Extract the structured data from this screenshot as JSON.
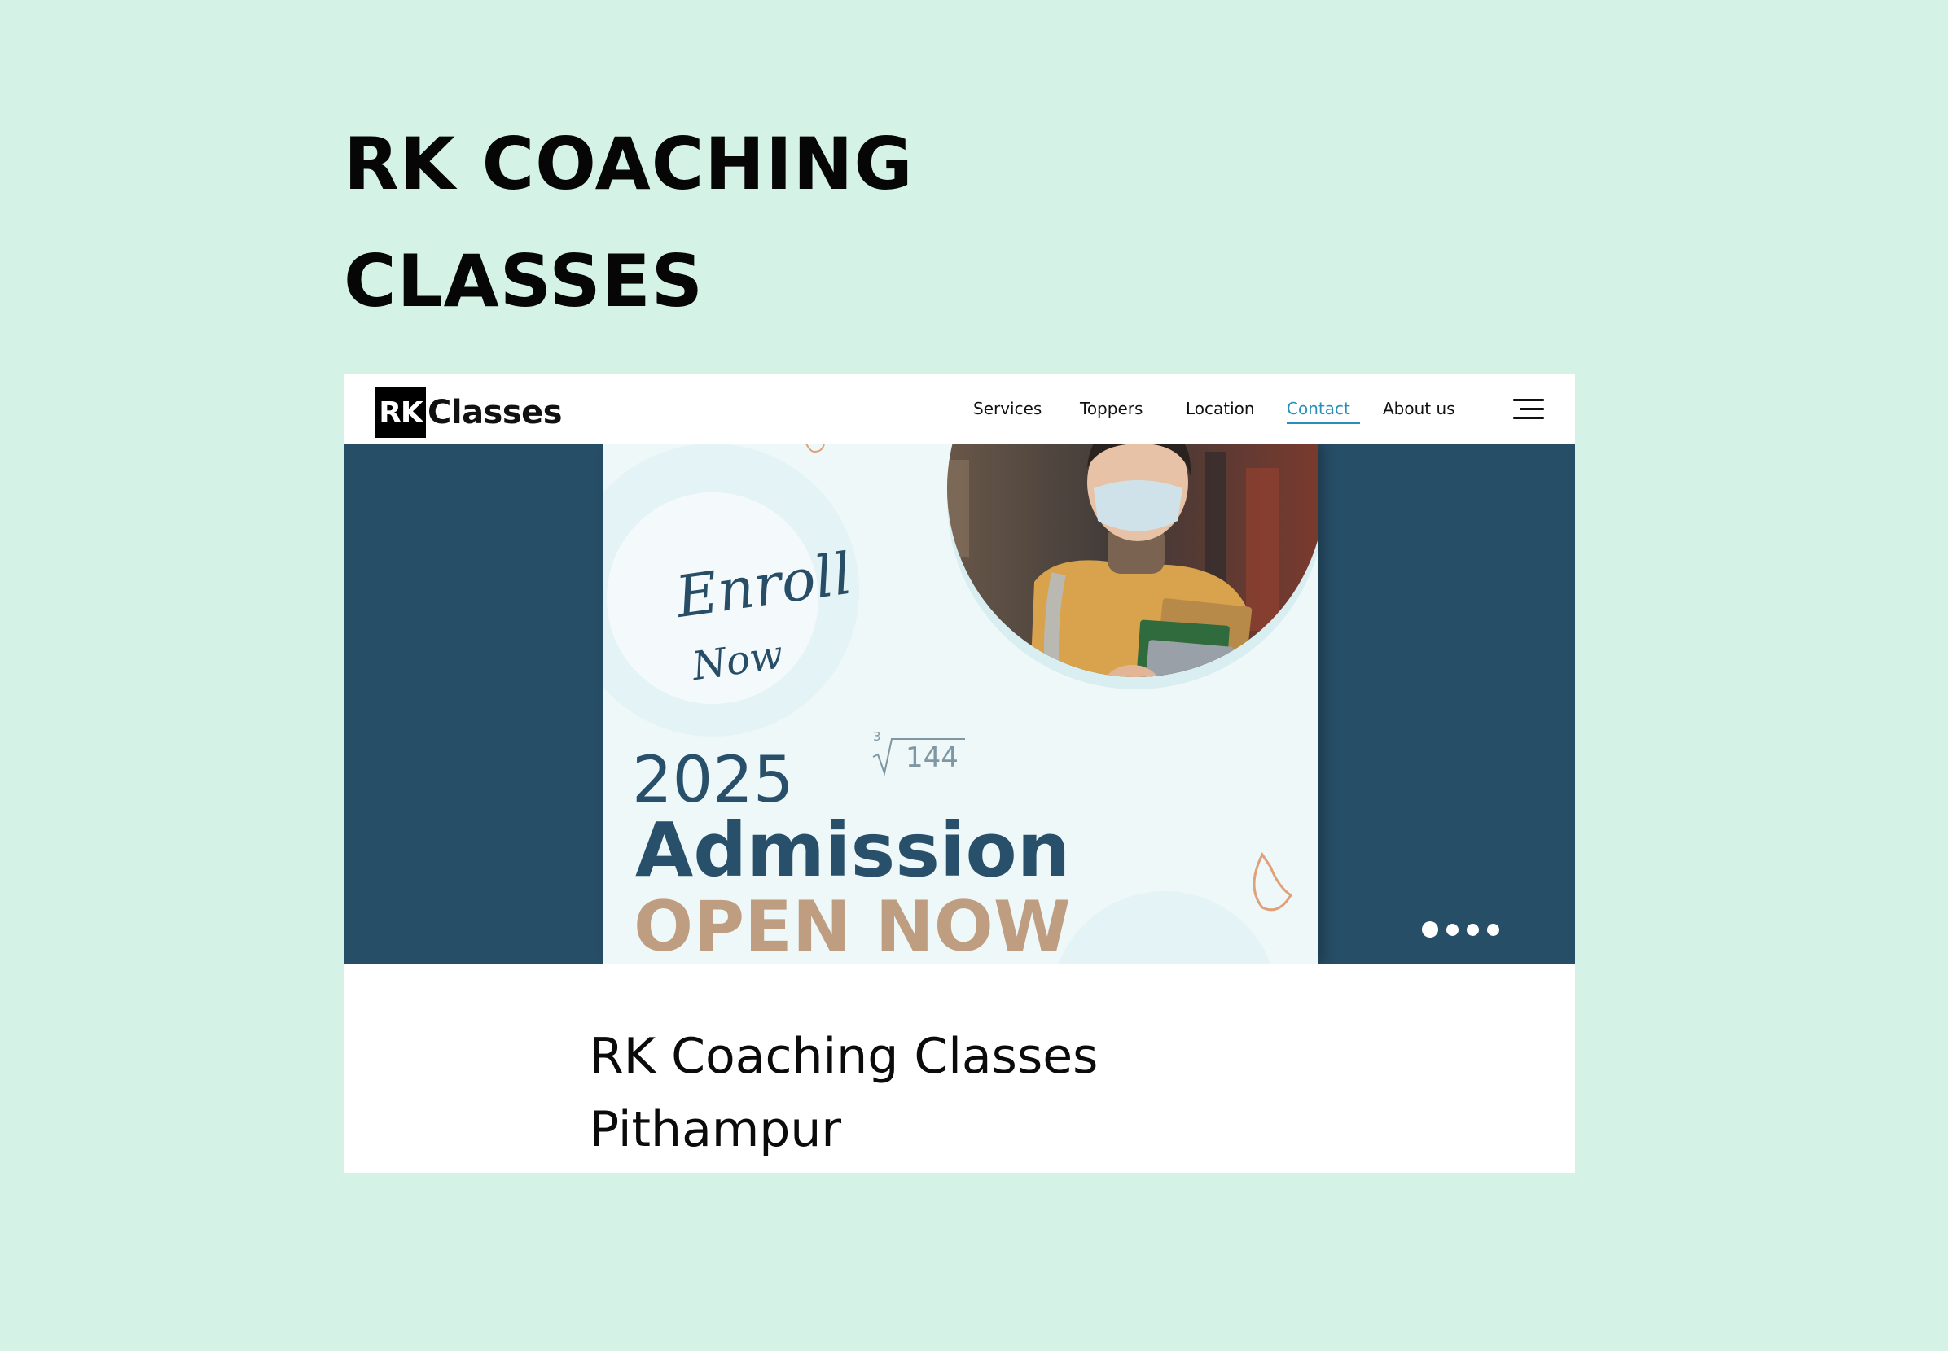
{
  "page": {
    "heading_line1": "RK COACHING",
    "heading_line2": "CLASSES",
    "background_color": "#d4f3e6"
  },
  "site": {
    "logo": {
      "mark": "RK",
      "text": "Classes"
    },
    "nav": {
      "items": [
        {
          "label": "Services"
        },
        {
          "label": "Toppers"
        },
        {
          "label": "Location"
        },
        {
          "label": "Contact",
          "active": true
        },
        {
          "label": "About us"
        }
      ],
      "active_color": "#2a8fb8"
    },
    "hero": {
      "background_color": "#274e67",
      "banner": {
        "script_line1": "Enroll",
        "script_line2": "Now",
        "math_index": "3",
        "math_radicand": "144",
        "year": "2025",
        "headline": "Admission",
        "subheadline": "OPEN NOW",
        "headline_color": "#29506b",
        "subheadline_color": "#bf9d80"
      },
      "slider": {
        "slide_count": 4,
        "active_index": 0
      }
    },
    "title_line1": "RK Coaching Classes",
    "title_line2": "Pithampur"
  }
}
